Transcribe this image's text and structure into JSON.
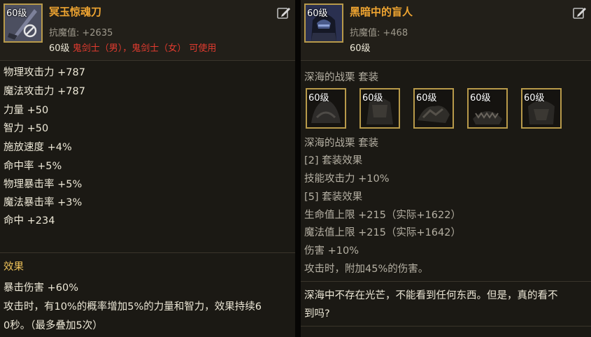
{
  "left": {
    "item_level_badge": "60级",
    "item_name": "冥玉惊魂刀",
    "resist_label": "抗魔值:",
    "resist_value": "+2635",
    "req_level": "60级",
    "req_classes": "鬼剑士（男），鬼剑士（女）",
    "req_suffix": "可使用",
    "stats": [
      "物理攻击力 +787",
      "魔法攻击力 +787",
      "力量 +50",
      "智力 +50",
      "施放速度 +4%",
      "命中率 +5%",
      "物理暴击率 +5%",
      "魔法暴击率 +3%",
      "命中 +234"
    ],
    "effect_title": "效果",
    "effect_lines": [
      "暴击伤害 +60%",
      "攻击时，有10%的概率增加5%的力量和智力，效果持续6",
      "0秒。（最多叠加5次）"
    ]
  },
  "right": {
    "item_level_badge": "60级",
    "item_name": "黑暗中的盲人",
    "resist_label": "抗魔值:",
    "resist_value": "+468",
    "req_level": "60级",
    "set_heading": "深海的战栗 套装",
    "set_items": [
      "60级",
      "60级",
      "60级",
      "60级",
      "60级"
    ],
    "set_heading2": "深海的战栗 套装",
    "bonus2_label": "[2] 套装效果",
    "bonus2_stats": [
      "技能攻击力 +10%"
    ],
    "bonus5_label": "[5] 套装效果",
    "bonus5_stats": [
      "生命值上限 +215（实际+1622）",
      "魔法值上限 +215（实际+1642）",
      "伤害 +10%",
      "攻击时，附加45%的伤害。"
    ],
    "flavor_lines": [
      "深海中不存在光芒，不能看到任何东西。但是，真的看不",
      "到吗?"
    ]
  },
  "colors": {
    "title": "#f0a531",
    "class_restriction": "#e23b2f",
    "effect_title": "#f0c45a",
    "border_gold": "#b89a4a"
  },
  "icons": {
    "edit": "edit-icon",
    "blocked": "no-entry-icon"
  }
}
